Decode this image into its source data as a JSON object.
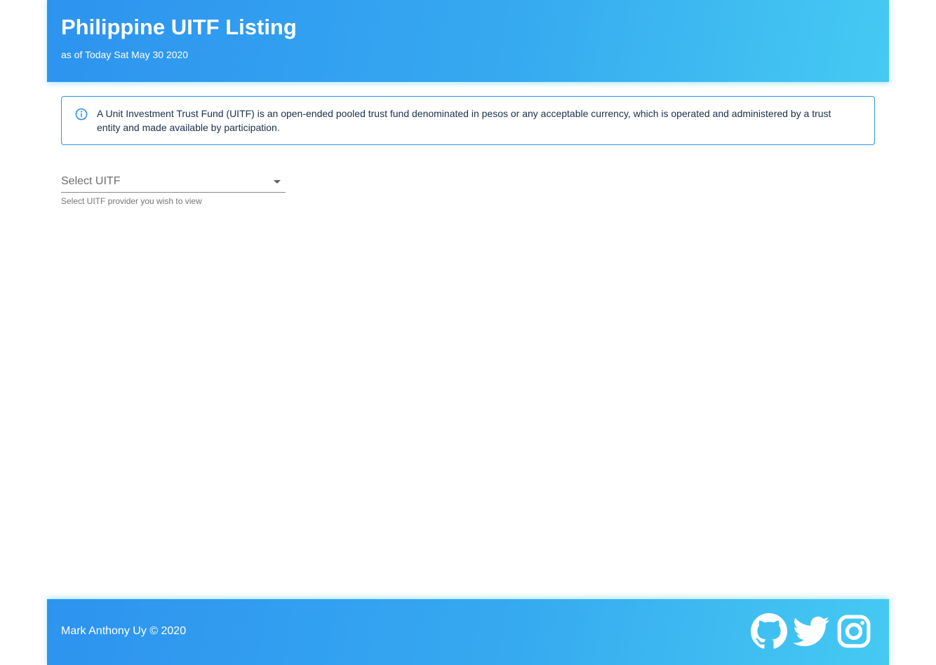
{
  "header": {
    "title": "Philippine UITF Listing",
    "subtitle": "as of Today Sat May 30 2020"
  },
  "info": {
    "icon": "info-circle-icon",
    "text": "A Unit Investment Trust Fund (UITF) is an open-ended pooled trust fund denominated in pesos or any acceptable currency, which is operated and administered by a trust entity and made available by participation."
  },
  "select": {
    "placeholder": "Select UITF",
    "hint": "Select UITF provider you wish to view"
  },
  "footer": {
    "text": "Mark Anthony Uy © 2020",
    "social": [
      "github-icon",
      "twitter-icon",
      "instagram-icon"
    ]
  },
  "colors": {
    "gradient_start": "#2d93ef",
    "gradient_end": "#45caf2",
    "info_border": "#2d93ef",
    "info_text": "#1a2f4a"
  }
}
